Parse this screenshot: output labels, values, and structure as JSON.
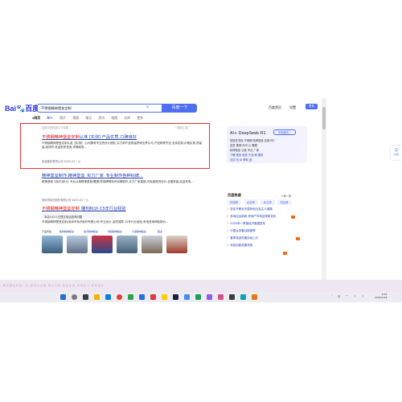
{
  "header": {
    "logo_bai": "Bai",
    "logo_du": "du",
    "logo_cn": "百度",
    "query": "不锈钢精神堡垒定制",
    "clear": "×",
    "search_button": "百度一下",
    "links": [
      "百度首页",
      "设置"
    ],
    "login": "登录"
  },
  "tabs": {
    "items": [
      "网页",
      "AI+",
      "图片",
      "视频",
      "笔记",
      "资讯",
      "地图",
      "文库",
      "更多"
    ],
    "tools": "搜索工具"
  },
  "results": [
    {
      "meta": "百度为您找到以下结果",
      "tools": "搜索工具",
      "title_pre": "不锈钢精神堡垒定制",
      "title_post": "认准 [实测] 产品优质,口碑良好",
      "desc": "不锈钢精神堡垒定制认准【实测】,公司拥有专业的设计团队,实力和产品质量获得业界认可,产品种类齐全,支持定制,价格实惠,质量高,品质好,欢迎前来咨询,详情致电...",
      "site": "精诚建材有限公司 2025-03",
      "ad": "广告"
    },
    {
      "title": "精神堡垒制作,精神堡垒_实力厂家_专业制作各种标牌...",
      "desc": "精神堡垒【标识设计】专业从事精神堡垒/雕塑/导视牌等标识标牌制作,实力厂家直销,可免费提供设计,全国安装,欢迎来电...",
      "site": "深圳市标识制作有限公司 2025-03",
      "ad": "广告"
    },
    {
      "title_pre": "不锈钢精神堡垒定制",
      "title_post": "_雕刻标识-15年行业经验",
      "bar": "本店142人已提交电话咨询问题",
      "desc": "不锈钢精神堡垒定制(深圳市标识制作有限公司)专业设计,品质保障,15年行业经验,来电咨询获取报价...",
      "captions": [
        "产品风格",
        "各种精神堡垒",
        "发光精神堡垒",
        "地铁精神堡垒",
        "大型精神堡垒",
        "更多"
      ]
    }
  ],
  "ai_box": {
    "title": "AI+ DeepSeek-R1",
    "button": "帮我解答 ›",
    "lines": [
      "您是在寻找 不锈钢 精神堡垒 定制 吗?",
      "这些 推荐 你可 以 看看",
      "精神堡垒 认准 专业 厂家",
      "了解 更多 相关 产品 和 服务",
      "试试 问 AI 帮你 选"
    ]
  },
  "hot": {
    "title": "百度热搜",
    "more": "换一换",
    "tabs": [
      "热搜榜",
      "北京榜",
      "民生榜",
      "财经榜"
    ],
    "items": [
      {
        "rank": "1",
        "text": "坚定不移走中国特色社会主义道路"
      },
      {
        "rank": "2",
        "text": "多地出台新政 房地产市场迎来新变化"
      },
      {
        "rank": "3",
        "text": "2025年一季度经济数据发布"
      },
      {
        "rank": "4",
        "text": "中国女排备战新赛季"
      },
      {
        "rank": "5",
        "text": "春季旅游热度持续上升"
      },
      {
        "rank": "6",
        "text": "科技创新成果亮相"
      }
    ]
  },
  "side_button": "反馈",
  "strip_text": "每天都是新的一天,保持好心情,努力工作,热爱生活,珍惜当下,感恩遇见",
  "taskbar": {
    "time": "8:25",
    "date": "2025/3/18",
    "tray": "中"
  },
  "colors": {
    "accent": "#4e6ef2",
    "link": "#2440b3",
    "highlight": "#e33333"
  }
}
